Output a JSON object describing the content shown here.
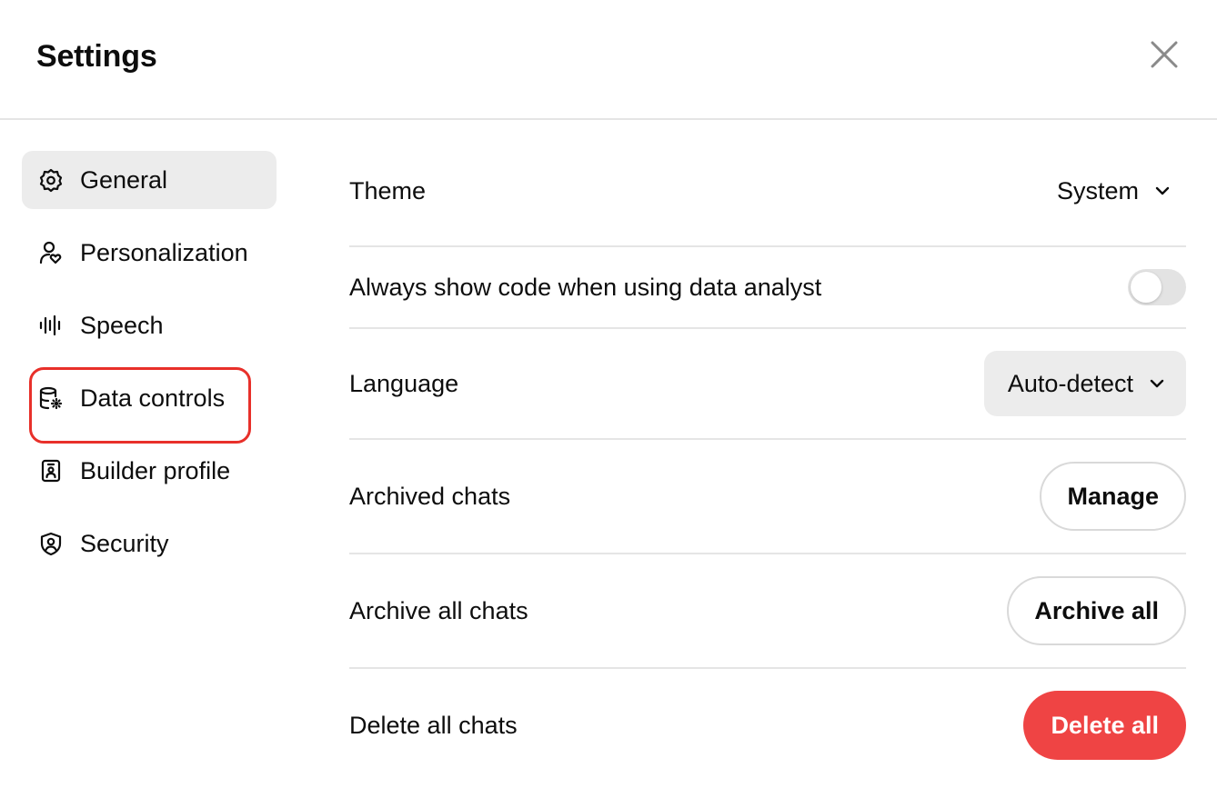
{
  "header": {
    "title": "Settings",
    "close_icon": "close-icon"
  },
  "sidebar": {
    "items": [
      {
        "label": "General",
        "icon": "gear-icon",
        "active": true
      },
      {
        "label": "Personalization",
        "icon": "person-heart-icon",
        "active": false
      },
      {
        "label": "Speech",
        "icon": "waveform-icon",
        "active": false
      },
      {
        "label": "Data controls",
        "icon": "database-gear-icon",
        "active": false,
        "highlighted": true
      },
      {
        "label": "Builder profile",
        "icon": "id-badge-icon",
        "active": false
      },
      {
        "label": "Security",
        "icon": "shield-user-icon",
        "active": false
      }
    ]
  },
  "general": {
    "theme": {
      "label": "Theme",
      "value": "System"
    },
    "show_code": {
      "label": "Always show code when using data analyst",
      "enabled": false
    },
    "language": {
      "label": "Language",
      "value": "Auto-detect"
    },
    "archived_chats": {
      "label": "Archived chats",
      "button": "Manage"
    },
    "archive_all": {
      "label": "Archive all chats",
      "button": "Archive all"
    },
    "delete_all": {
      "label": "Delete all chats",
      "button": "Delete all"
    }
  },
  "colors": {
    "danger": "#ef4444",
    "highlight": "#e8302a",
    "active_bg": "#ececec"
  }
}
